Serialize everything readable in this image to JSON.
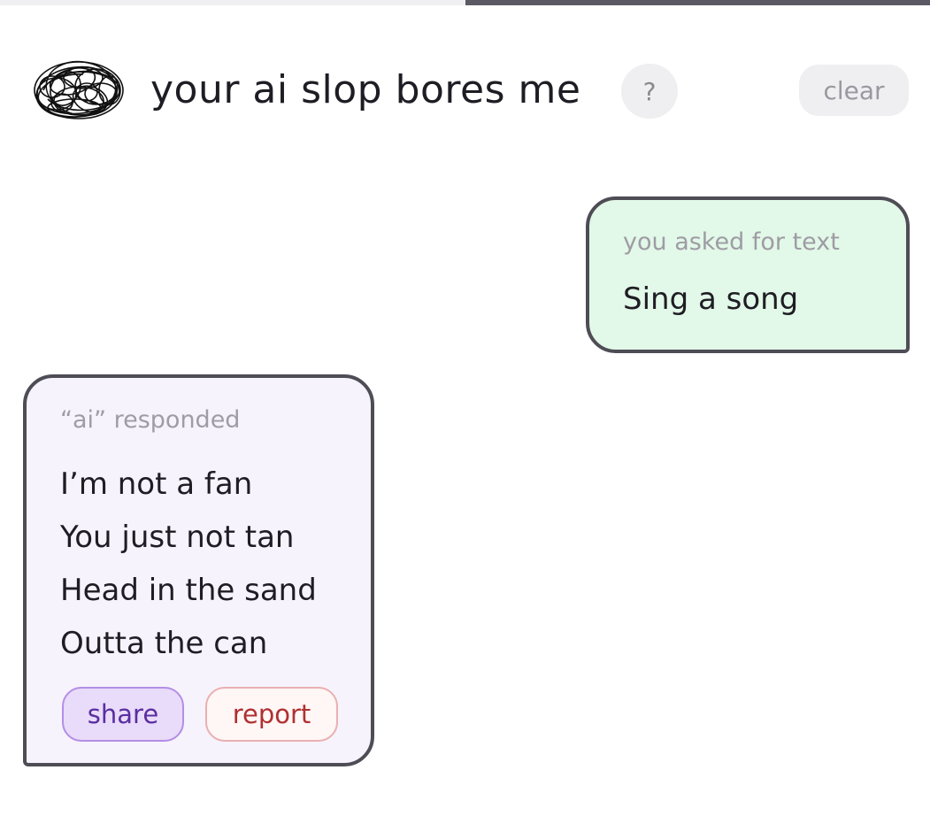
{
  "header": {
    "title": "your ai slop bores me",
    "help_label": "?",
    "clear_label": "clear",
    "logo_icon": "scribble-logo-icon"
  },
  "loading_progress": 0.5,
  "conversation": {
    "user_message": {
      "caption": "you asked for text",
      "text": "Sing a song"
    },
    "ai_message": {
      "caption": "“ai” responded",
      "lines": [
        "I’m not a fan",
        "You just not tan",
        "Head in the sand",
        "Outta the can"
      ],
      "share_label": "share",
      "report_label": "report"
    }
  },
  "colors": {
    "user_bubble_bg": "#e2f8e8",
    "ai_bubble_bg": "#f6f3fd",
    "bubble_border": "#4e4c55",
    "share_text": "#5a2ea0",
    "report_text": "#b03030"
  }
}
